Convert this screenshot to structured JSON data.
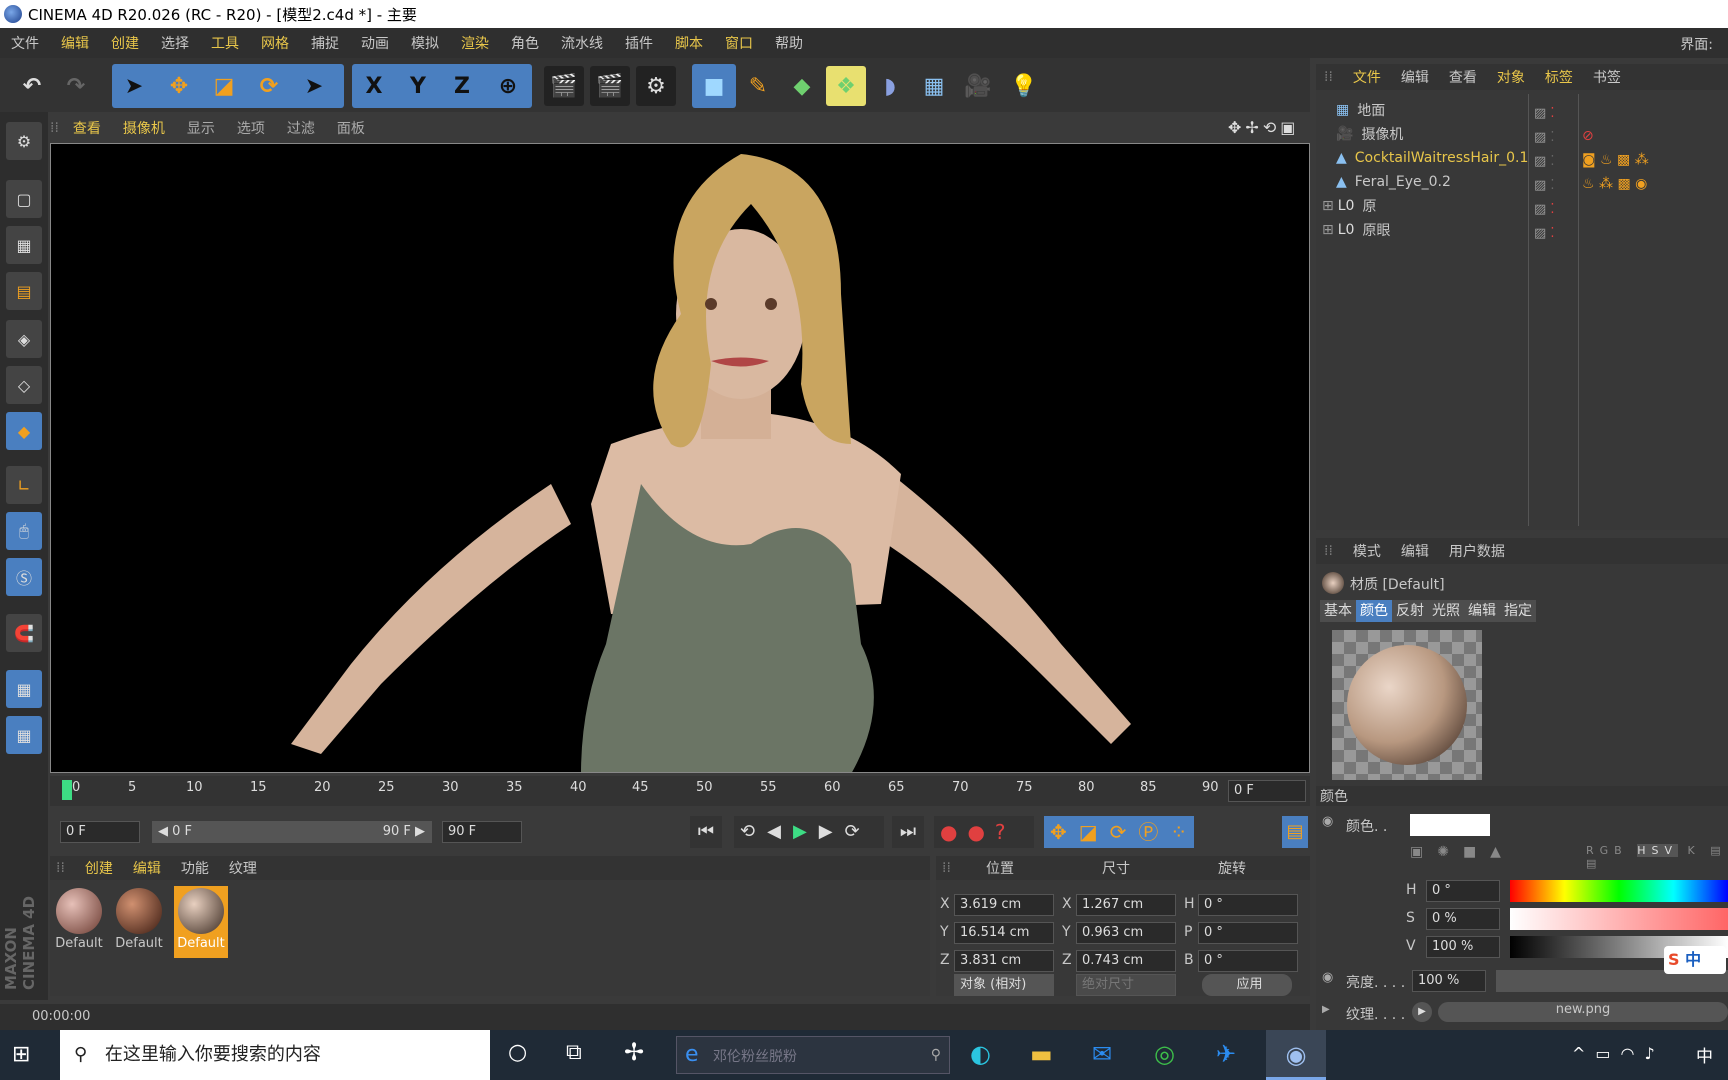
{
  "title": "CINEMA 4D R20.026 (RC - R20) - [模型2.c4d *] - 主要",
  "menu": [
    "文件",
    "编辑",
    "创建",
    "选择",
    "工具",
    "网格",
    "捕捉",
    "动画",
    "模拟",
    "渲染",
    "角色",
    "流水线",
    "插件",
    "脚本",
    "窗口",
    "帮助"
  ],
  "menu_right": "界面:",
  "axis_btns": [
    "X",
    "Y",
    "Z"
  ],
  "viewport_menu": [
    "查看",
    "摄像机",
    "显示",
    "选项",
    "过滤",
    "面板"
  ],
  "timeline_ticks": [
    "0",
    "5",
    "10",
    "15",
    "20",
    "25",
    "30",
    "35",
    "40",
    "45",
    "50",
    "55",
    "60",
    "65",
    "70",
    "75",
    "80",
    "85",
    "90"
  ],
  "timeline_frame": "0 F",
  "transport": {
    "start": "0 F",
    "range_left": "◀ 0 F",
    "range_right": "90 F ▶",
    "end": "90 F"
  },
  "mat_tabs": [
    "创建",
    "编辑",
    "功能",
    "纹理"
  ],
  "materials": [
    "Default",
    "Default",
    "Default"
  ],
  "coord_headers": [
    "位置",
    "尺寸",
    "旋转"
  ],
  "coords": {
    "pos": [
      {
        "axis": "X",
        "val": "3.619 cm"
      },
      {
        "axis": "Y",
        "val": "16.514 cm"
      },
      {
        "axis": "Z",
        "val": "3.831 cm"
      }
    ],
    "size": [
      {
        "axis": "X",
        "val": "1.267 cm"
      },
      {
        "axis": "Y",
        "val": "0.963 cm"
      },
      {
        "axis": "Z",
        "val": "0.743 cm"
      }
    ],
    "rot": [
      {
        "axis": "H",
        "val": "0 °"
      },
      {
        "axis": "P",
        "val": "0 °"
      },
      {
        "axis": "B",
        "val": "0 °"
      }
    ]
  },
  "coord_mode": "对象 (相对)",
  "coord_size_mode": "绝对尺寸",
  "apply": "应用",
  "status_time": "00:00:00",
  "obj_tabs": [
    "文件",
    "编辑",
    "查看",
    "对象",
    "标签",
    "书签"
  ],
  "objects": [
    {
      "name": "地面",
      "color": "#c8c8c8"
    },
    {
      "name": "摄像机",
      "color": "#c8c8c8"
    },
    {
      "name": "CocktailWaitressHair_0.1",
      "color": "#e8c64a"
    },
    {
      "name": "Feral_Eye_0.2",
      "color": "#c8c8c8"
    },
    {
      "name": "原",
      "color": "#c8c8c8"
    },
    {
      "name": "原眼",
      "color": "#c8c8c8"
    }
  ],
  "attr_tabs": [
    "模式",
    "编辑",
    "用户数据"
  ],
  "attr_title": "材质 [Default]",
  "attr_subtabs": [
    "基本",
    "颜色",
    "反射",
    "光照",
    "编辑",
    "指定"
  ],
  "color_section": "颜色",
  "color_label": "颜色. .",
  "hsv": [
    {
      "k": "H",
      "v": "0 °"
    },
    {
      "k": "S",
      "v": "0 %"
    },
    {
      "k": "V",
      "v": "100 %"
    }
  ],
  "brightness_label": "亮度. . . .",
  "brightness": "100 %",
  "texture_label": "纹理. . . .",
  "texture_file": "new.png",
  "taskbar_search": "在这里输入你要搜索的内容",
  "ie_text": "邓伦粉丝脱粉",
  "tray_lang": "中",
  "ime_lang": "中"
}
